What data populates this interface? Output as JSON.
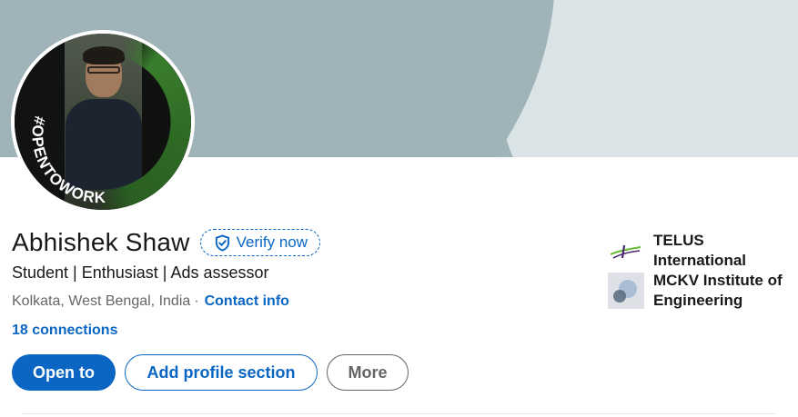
{
  "profile": {
    "name": "Abhishek Shaw",
    "verify_label": "Verify now",
    "headline": "Student | Enthusiast | Ads assessor",
    "location": "Kolkata, West Bengal, India",
    "separator": "·",
    "contact_info": "Contact info",
    "connections": "18 connections",
    "badge_text": "#OPENTOWORK"
  },
  "actions": {
    "open_to": "Open to",
    "add_section": "Add profile section",
    "more": "More"
  },
  "sidebar": {
    "experience": "TELUS International",
    "education": "MCKV Institute of Engineering"
  },
  "colors": {
    "accent": "#0a66c2",
    "badge_green": "#3a7d2e",
    "cover": "#a0b4ba"
  },
  "icons": {
    "verify": "shield-check-icon",
    "experience_logo": "telus-logo-icon",
    "education_logo": "school-logo-icon"
  }
}
